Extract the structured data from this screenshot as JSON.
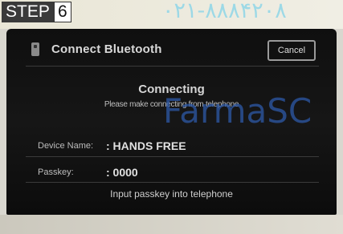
{
  "step": {
    "word": "STEP",
    "number": "6"
  },
  "watermark": {
    "phone": "۰۲۱-۸۸۸۴۲۰۸",
    "brand": "FarmaSC"
  },
  "dialog": {
    "title": "Connect Bluetooth",
    "cancel_label": "Cancel",
    "status_title": "Connecting",
    "status_message": "Please make connecting from telephone",
    "device_name_label": "Device Name:",
    "device_name_value": ": HANDS FREE",
    "passkey_label": "Passkey:",
    "passkey_value": ": 0000",
    "hint": "Input passkey into telephone"
  },
  "colors": {
    "screen_background": "#111111",
    "watermark_brand": "#2d59a8",
    "watermark_phone": "#8fd6e8"
  },
  "icons": {
    "header_icon": "phone-icon"
  }
}
